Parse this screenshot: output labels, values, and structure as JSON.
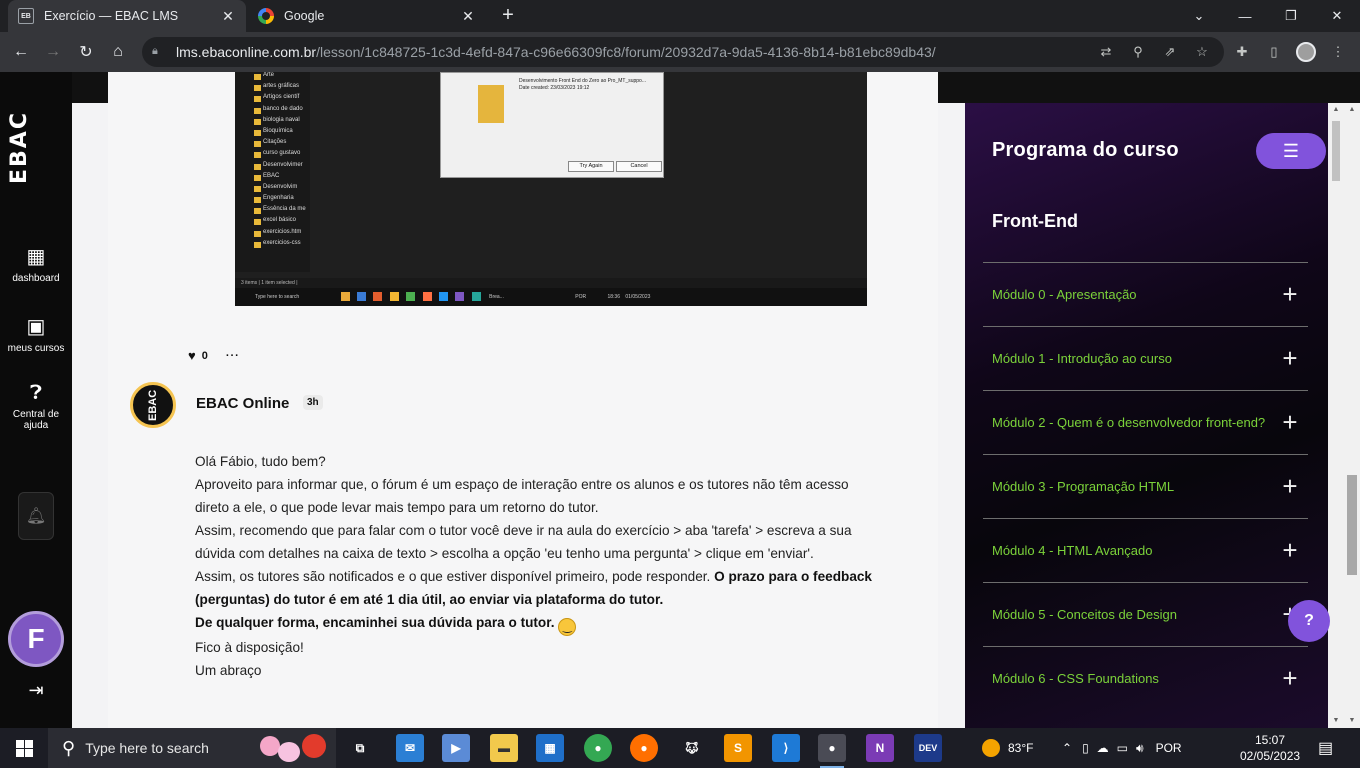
{
  "browser": {
    "tabs": [
      {
        "title": "Exercício — EBAC LMS",
        "icon": "ebac-favicon",
        "active": true
      },
      {
        "title": "Google",
        "icon": "google-favicon",
        "active": false
      }
    ],
    "url_domain": "lms.ebaconline.com.br",
    "url_path": "/lesson/1c848725-1c3d-4efd-847a-c96e66309fc8/forum/20932d7a-9da5-4136-8b14-b81ebc89db43/"
  },
  "leftnav": {
    "logo_text": "EBAC",
    "items": [
      {
        "label": "dashboard",
        "icon": "dashboard-icon"
      },
      {
        "label": "meus cursos",
        "icon": "courses-icon"
      },
      {
        "label": "Central de ajuda",
        "icon": "help-icon"
      }
    ],
    "user_initial": "F"
  },
  "screenshot": {
    "folders": [
      "Arte",
      "artes gráficas",
      "Artigos científ",
      "banco de dado",
      "biologia naval",
      "Bioquímica",
      "Citações",
      "curso gustavo",
      "Desenvolvimer",
      "EBAC",
      "Desenvolvim",
      "Engenharia",
      "Essência da me",
      "excel básico",
      "exercicios.htm",
      "exercicios-css"
    ],
    "dialog_line1": "Desenvolvimento Front End do Zero ao Pro_MT_suppo...",
    "dialog_line2": "Date created: 23/03/2023 19:12",
    "try_again": "Try Again",
    "cancel": "Cancel",
    "status": "3 items  |  1 item selected  |",
    "task_search": "Type here to search",
    "task_time": "18:36",
    "task_date": "01/05/2023",
    "task_lang": "POR",
    "task_app": "Brea..."
  },
  "post": {
    "likes": "0",
    "author": "EBAC Online",
    "time_ago": "3h",
    "greeting": "Olá Fábio, tudo bem?",
    "p1": "Aproveito para informar que, o fórum é um espaço de interação entre os alunos e os tutores não têm acesso direto a ele, o que pode levar mais tempo para um retorno do tutor.",
    "p2": "Assim, recomendo que para falar com o tutor você deve ir na aula do exercício > aba 'tarefa' > escreva a sua dúvida com detalhes na caixa de texto > escolha a opção 'eu tenho uma pergunta' > clique em 'enviar'.",
    "p3_plain": "Assim, os tutores são notificados e o que estiver disponível primeiro, pode responder. ",
    "p3_bold": "O prazo para o feedback (perguntas) do tutor é em até 1 dia útil, ao enviar via plataforma do tutor.",
    "p4_bold": "De qualquer forma, encaminhei sua dúvida para o tutor.",
    "p5": "Fico à disposição!",
    "p6": "Um abraço"
  },
  "side": {
    "title": "Programa do curso",
    "course": "Front-End",
    "modules": [
      "Módulo 0 - Apresentação",
      "Módulo 1 - Introdução ao curso",
      "Módulo 2 - Quem é o desenvolvedor front-end?",
      "Módulo 3 - Programação HTML",
      "Módulo 4 - HTML Avançado",
      "Módulo 5 - Conceitos de Design",
      "Módulo 6 - CSS Foundations"
    ],
    "accent": "#7bd23a",
    "button_color": "#8153dc"
  },
  "taskbar": {
    "search_placeholder": "Type here to search",
    "weather": "83°F",
    "lang": "POR",
    "time": "15:07",
    "date": "02/05/2023"
  }
}
